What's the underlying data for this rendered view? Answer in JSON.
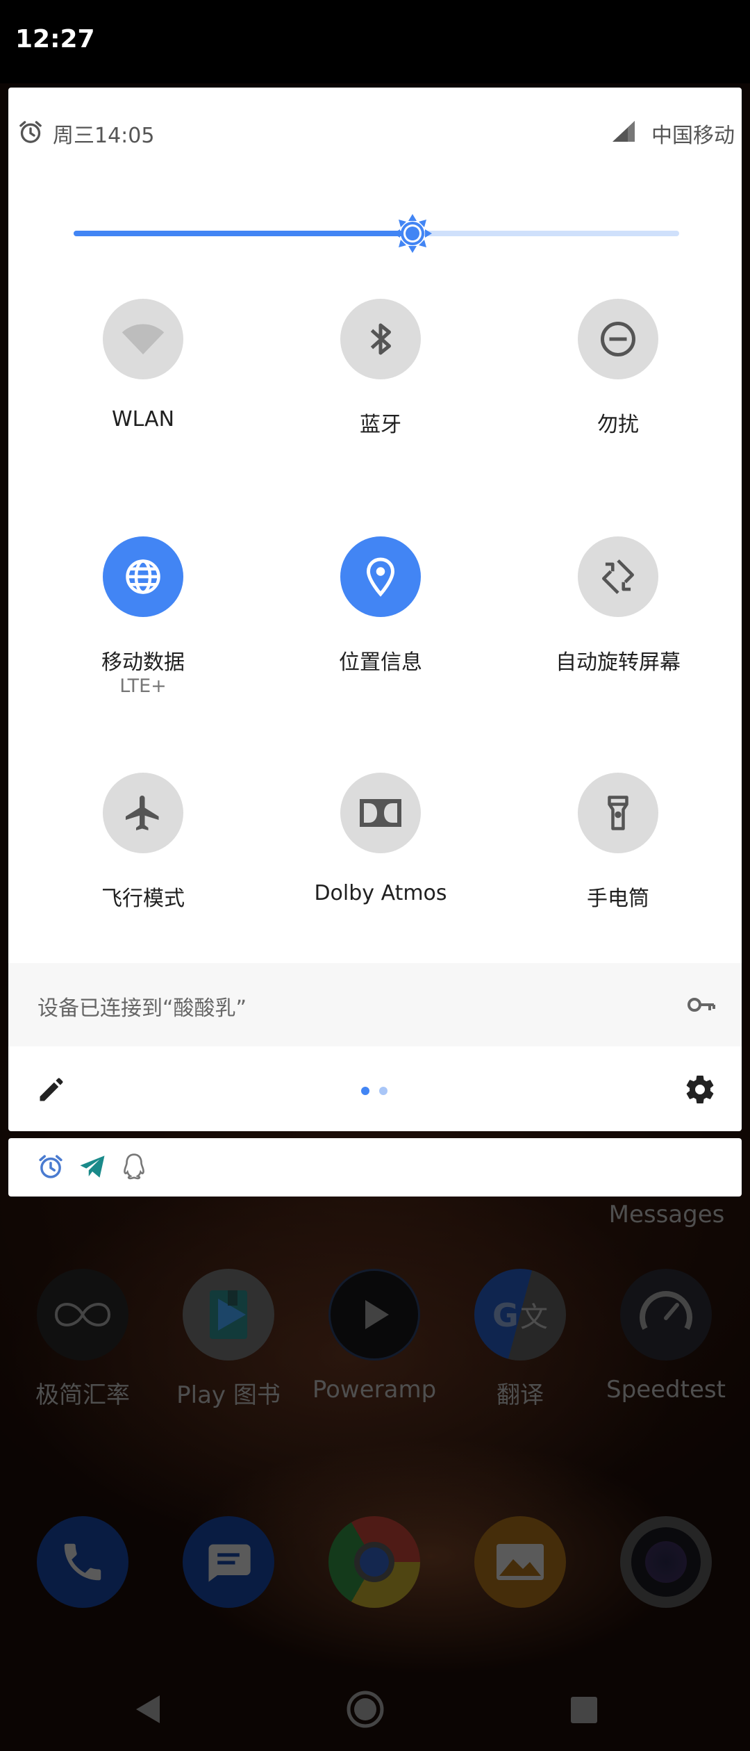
{
  "status_bar": {
    "time": "12:27"
  },
  "quick_settings": {
    "header": {
      "date": "周三14:05",
      "carrier": "中国移动"
    },
    "brightness": {
      "level": 0.56
    },
    "tiles": [
      {
        "label": "WLAN",
        "sublabel": "",
        "icon": "wifi-icon",
        "active": false
      },
      {
        "label": "蓝牙",
        "sublabel": "",
        "icon": "bluetooth-icon",
        "active": false
      },
      {
        "label": "勿扰",
        "sublabel": "",
        "icon": "do-not-disturb-icon",
        "active": false
      },
      {
        "label": "移动数据",
        "sublabel": "LTE+",
        "icon": "globe-icon",
        "active": true
      },
      {
        "label": "位置信息",
        "sublabel": "",
        "icon": "location-pin-icon",
        "active": true
      },
      {
        "label": "自动旋转屏幕",
        "sublabel": "",
        "icon": "auto-rotate-icon",
        "active": false
      },
      {
        "label": "飞行模式",
        "sublabel": "",
        "icon": "airplane-icon",
        "active": false
      },
      {
        "label": "Dolby Atmos",
        "sublabel": "",
        "icon": "dolby-icon",
        "active": false
      },
      {
        "label": "手电筒",
        "sublabel": "",
        "icon": "flashlight-icon",
        "active": false
      }
    ],
    "vpn_text": "设备已连接到“酸酸乳”",
    "pager": {
      "pages": 2,
      "current": 1
    }
  },
  "notifications": {
    "icons": [
      "alarm-icon",
      "telegram-icon",
      "qq-icon"
    ]
  },
  "home": {
    "messages_label": "Messages",
    "apps": [
      {
        "label": "极简汇率",
        "icon": "infinity-icon"
      },
      {
        "label": "Play 图书",
        "icon": "play-books-icon"
      },
      {
        "label": "Poweramp",
        "icon": "play-icon"
      },
      {
        "label": "翻译",
        "icon": "translate-icon"
      },
      {
        "label": "Speedtest",
        "icon": "speedometer-icon"
      }
    ],
    "dock": [
      {
        "icon": "phone-icon"
      },
      {
        "icon": "messages-icon"
      },
      {
        "icon": "chrome-icon"
      },
      {
        "icon": "gallery-icon"
      },
      {
        "icon": "camera-icon"
      }
    ]
  },
  "colors": {
    "accent": "#4285f4",
    "tile_off": "#dcdcdc",
    "scrim": "#000000"
  }
}
